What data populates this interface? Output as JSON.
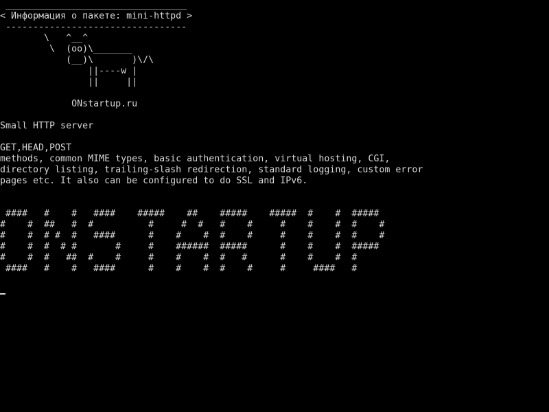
{
  "terminal": {
    "bubble": {
      "top_border": " _________________________________",
      "title": "< Информация о пакете: mini-httpd >",
      "bottom_border": " ---------------------------------"
    },
    "cow": [
      "        \\   ^__^",
      "         \\  (oo)\\_______",
      "            (__)\\       )\\/\\",
      "                ||----w |",
      "                ||     ||"
    ],
    "brand": "             ONstartup.ru",
    "summary": "Small HTTP server",
    "description": [
      "GET,HEAD,POST",
      "methods, common MIME types, basic authentication, virtual hosting, CGI,",
      "directory listing, trailing-slash redirection, standard logging, custom error",
      "pages etc. It also can be configured to do SSL and IPv6."
    ],
    "banner": [
      " ####   #    #   ####    #####    ##    #####    #####  #    #  #####",
      "#    #  ##   #  #          #     #  #   #    #     #    #    #  #    #",
      "#    #  # #  #   ####      #    #    #  #    #     #    #    #  #    #",
      "#    #  #  # #       #     #    ######  #####      #    #    #  #####",
      "#    #  #   ##  #    #     #    #    #  #   #      #    #    #  #",
      " ####   #    #   ####      #    #    #  #    #     #     ####   #"
    ],
    "cursor": "_"
  }
}
